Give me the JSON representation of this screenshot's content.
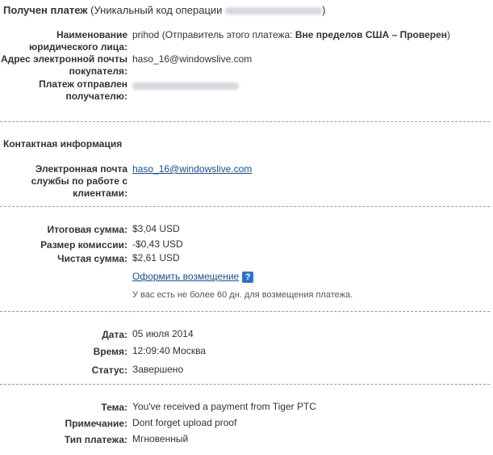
{
  "header": {
    "title": "Получен платеж",
    "code_prefix": "(Уникальный код операции",
    "code_suffix": ")"
  },
  "details": {
    "legal_name_label_1": "Наименование",
    "legal_name_label_2": "юридического лица:",
    "legal_name_value": "prihod (Отправитель этого платежа: ",
    "legal_name_status": "Вне пределов США – Проверен",
    "legal_name_close": ")",
    "recipient_email_label_1": "Адрес электронной почты",
    "recipient_email_label_2": "покупателя:",
    "recipient_email_value": "haso_16@windowslive.com",
    "sent_to_label_1": "Платеж отправлен",
    "sent_to_label_2": "получателю:"
  },
  "contact": {
    "section_title": "Контактная информация",
    "support_email_label_1": "Электронная почта",
    "support_email_label_2": "службы по работе с",
    "support_email_label_3": "клиентами:",
    "support_email_value": "haso_16@windowslive.com"
  },
  "amounts": {
    "total_label": "Итоговая сумма:",
    "total_value": "$3,04 USD",
    "fee_label": "Размер комиссии:",
    "fee_value": "-$0,43 USD",
    "net_label": "Чистая сумма:",
    "net_value": "$2,61 USD",
    "refund_link": "Оформить возмещение",
    "help_icon": "?",
    "refund_note": "У вас есть не более 60 дн. для возмещения платежа."
  },
  "status": {
    "date_label": "Дата:",
    "date_value": "05 июля 2014",
    "time_label": "Время:",
    "time_value": "12:09:40 Москва",
    "status_label": "Статус:",
    "status_value": "Завершено"
  },
  "message": {
    "subject_label": "Тема:",
    "subject_value": "You've received a payment from Tiger PTC",
    "note_label": "Примечание:",
    "note_value": "Dont forget upload proof",
    "type_label": "Тип платежа:",
    "type_value": "Мгновенный"
  }
}
